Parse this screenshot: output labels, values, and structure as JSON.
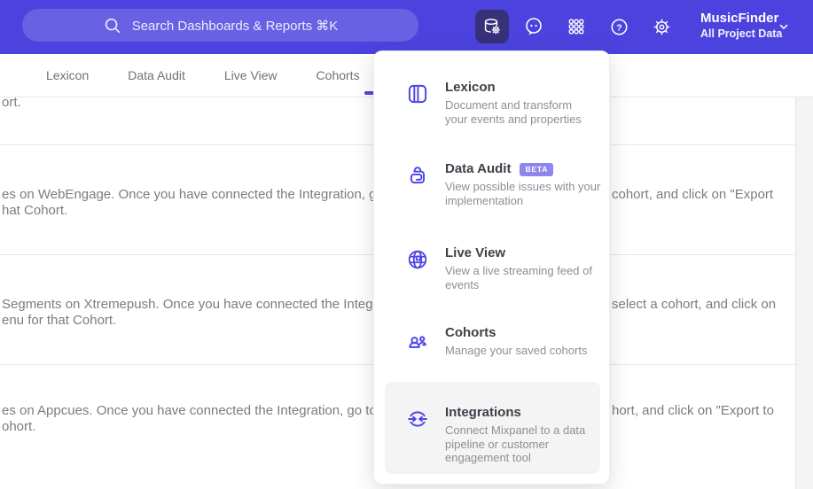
{
  "colors": {
    "header_bg": "#4c43df",
    "accent": "#4f44e0",
    "active_icon_bg": "#373179",
    "menu_icon_purple": "#4f46e5",
    "badge_bg": "#8f85ee",
    "highlight_bg": "#f4f4f5"
  },
  "header": {
    "search_placeholder": "Search Dashboards & Reports ⌘K",
    "project_name": "MusicFinder",
    "project_scope": "All Project Data",
    "icons": [
      "data-management-icon",
      "feedback-chat-icon",
      "apps-grid-icon",
      "help-icon",
      "settings-gear-icon",
      "chevron-down-icon"
    ]
  },
  "tabs": {
    "t0": "Lexicon",
    "t1": "Data Audit",
    "t2": "Live View",
    "t3": "Cohorts"
  },
  "content": {
    "r1l1": "ort.",
    "r2l1": "es on WebEngage. Once you have connected the Integration, go to the",
    "r2r1": "cohort, and click on \"Export",
    "r2l2": "hat Cohort.",
    "r3l1": "Segments on Xtremepush. Once you have connected the Integration,",
    "r3r1": "select a cohort, and click on",
    "r3l2": "enu for that Cohort.",
    "r4l1": "es on Appcues. Once you have connected the Integration, go to the M",
    "r4r1": "hort, and click on \"Export to",
    "r4l2": "ohort."
  },
  "menu": {
    "items": [
      {
        "title": "Lexicon",
        "icon": "book-icon",
        "desc": {
          "l1": "Document and transform",
          "l2": "your events and properties"
        }
      },
      {
        "title": "Data Audit",
        "badge": "BETA",
        "icon": "audit-lock-icon",
        "desc": {
          "l1": "View possible issues with your",
          "l2": "implementation"
        }
      },
      {
        "title": "Live View",
        "icon": "globe-icon",
        "desc": {
          "l1": "View a live streaming feed of",
          "l2": "events"
        }
      },
      {
        "title": "Cohorts",
        "icon": "people-icon",
        "desc": {
          "l1": "Manage your saved cohorts"
        }
      },
      {
        "title": "Integrations",
        "icon": "sync-arrows-icon",
        "desc": {
          "l1": "Connect Mixpanel to a data",
          "l2": "pipeline or customer",
          "l3": "engagement tool"
        }
      }
    ]
  }
}
